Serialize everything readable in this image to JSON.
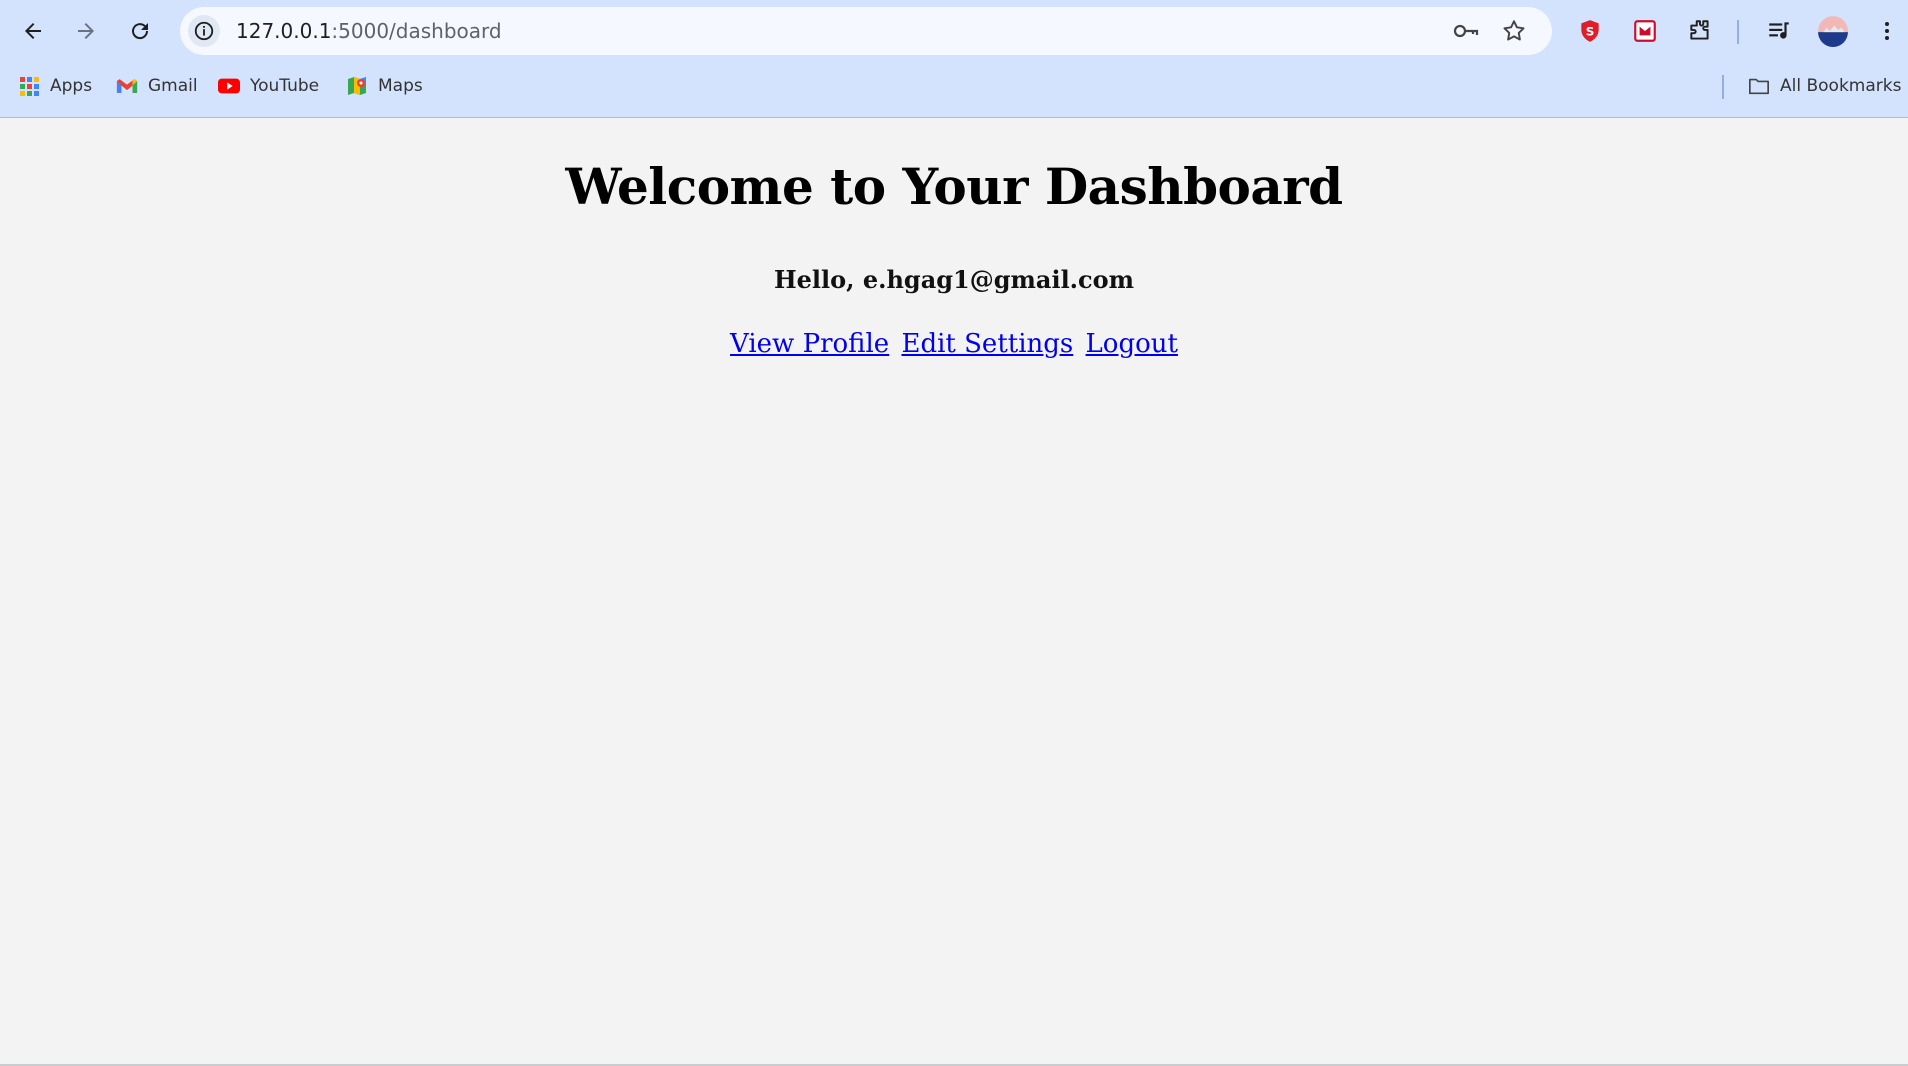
{
  "browser": {
    "url_host": "127.0.0.1",
    "url_path": ":5000/dashboard",
    "bookmarks": [
      {
        "label": "Apps",
        "icon": "apps-grid-icon"
      },
      {
        "label": "Gmail",
        "icon": "gmail-icon"
      },
      {
        "label": "YouTube",
        "icon": "youtube-icon"
      },
      {
        "label": "Maps",
        "icon": "maps-icon"
      }
    ],
    "all_bookmarks_label": "All Bookmarks",
    "colors": {
      "chrome_bg": "#d3e3fd",
      "omnibox_bg": "#f5f8ff",
      "page_bg": "#f3f3f3",
      "link": "#0000ee"
    }
  },
  "page": {
    "title": "Welcome to Your Dashboard",
    "greeting": "Hello, e.hgag1@gmail.com",
    "links": {
      "view_profile": "View Profile",
      "edit_settings": "Edit Settings",
      "logout": "Logout"
    }
  }
}
